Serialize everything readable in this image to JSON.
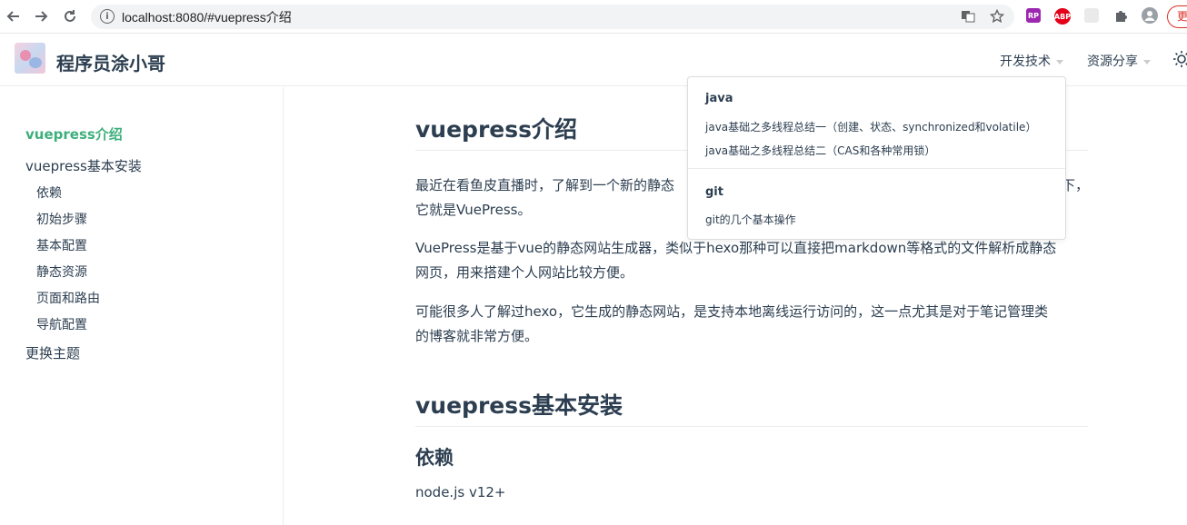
{
  "browser": {
    "url": "localhost:8080/#vuepress介绍",
    "update_label": "更"
  },
  "site": {
    "name": "程序员涂小哥",
    "nav": [
      {
        "label": "开发技术"
      },
      {
        "label": "资源分享"
      }
    ]
  },
  "sidebar": {
    "items": [
      {
        "label": "vuepress介绍"
      },
      {
        "label": "vuepress基本安装"
      },
      {
        "label": "依赖"
      },
      {
        "label": "初始步骤"
      },
      {
        "label": "基本配置"
      },
      {
        "label": "静态资源"
      },
      {
        "label": "页面和路由"
      },
      {
        "label": "导航配置"
      },
      {
        "label": "更换主题"
      }
    ]
  },
  "content": {
    "h1_intro": "vuepress介绍",
    "p1_line1": "最近在看鱼皮直播时，了解到一个新的静态",
    "p1_line1_tail": "下，",
    "p1_line2": "它就是VuePress。",
    "p2_line1": "VuePress是基于vue的静态网站生成器，类似于hexo那种可以直接把markdown等格式的文件解析成静态",
    "p2_line2": "网页，用来搭建个人网站比较方便。",
    "p3_line1": "可能很多人了解过hexo，它生成的静态网站，是支持本地离线运行访问的，这一点尤其是对于笔记管理类",
    "p3_line2": "的博客就非常方便。",
    "h1_install": "vuepress基本安装",
    "h3_deps": "依赖",
    "deps_text": "node.js v12+"
  },
  "dropdown": {
    "groups": [
      {
        "title": "java",
        "links": [
          {
            "label": "java基础之多线程总结一（创建、状态、synchronized和volatile）"
          },
          {
            "label": "java基础之多线程总结二（CAS和各种常用锁）"
          }
        ]
      },
      {
        "title": "git",
        "links": [
          {
            "label": "git的几个基本操作"
          }
        ]
      }
    ]
  },
  "colors": {
    "accent": "#3eaf7c",
    "text": "#2c3e50"
  }
}
